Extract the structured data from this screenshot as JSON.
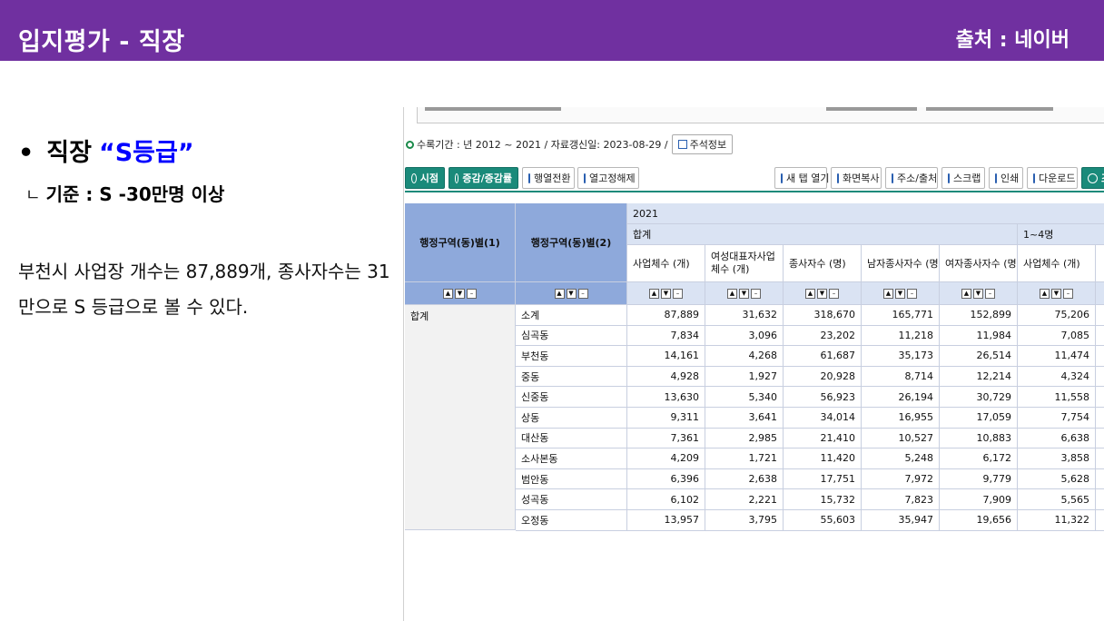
{
  "header": {
    "title": "입지평가 - 직장",
    "source": "출처 : 네이버"
  },
  "left": {
    "bullet": "•",
    "heading": "직장",
    "grade": "“S등급”",
    "criteria_mark": "ㄴ",
    "criteria": "기준 : S -30만명 이상",
    "description": "부천시 사업장 개수는 87,889개, 종사자수는 31만으로 S 등급으로 볼 수 있다."
  },
  "screenshot": {
    "meta": "수록기간 : 년 2012 ~ 2021 / 자료갱신일: 2023-08-29 /",
    "note_button": "주석정보",
    "toolbar_left": [
      "시점",
      "증감/증감률",
      "행열전환",
      "열고정해제"
    ],
    "toolbar_right": [
      "새 탭 열기",
      "화면복사",
      "주소/출처",
      "스크랩",
      "인쇄",
      "다운로드",
      "조"
    ],
    "table": {
      "row_header_1": "행정구역(동)별(1)",
      "row_header_2": "행정구역(동)별(2)",
      "year": "2021",
      "group_total": "합계",
      "group_small": "1~4명",
      "columns": [
        "사업체수 (개)",
        "여성대표자사업체수 (개)",
        "종사자수 (명)",
        "남자종사자수 (명)",
        "여자종사자수 (명)",
        "사업체수 (개)"
      ],
      "group_label": "합계",
      "rows": [
        {
          "name": "소계",
          "values": [
            "87,889",
            "31,632",
            "318,670",
            "165,771",
            "152,899",
            "75,206"
          ]
        },
        {
          "name": "심곡동",
          "values": [
            "7,834",
            "3,096",
            "23,202",
            "11,218",
            "11,984",
            "7,085"
          ]
        },
        {
          "name": "부천동",
          "values": [
            "14,161",
            "4,268",
            "61,687",
            "35,173",
            "26,514",
            "11,474"
          ]
        },
        {
          "name": "중동",
          "values": [
            "4,928",
            "1,927",
            "20,928",
            "8,714",
            "12,214",
            "4,324"
          ]
        },
        {
          "name": "신중동",
          "values": [
            "13,630",
            "5,340",
            "56,923",
            "26,194",
            "30,729",
            "11,558"
          ]
        },
        {
          "name": "상동",
          "values": [
            "9,311",
            "3,641",
            "34,014",
            "16,955",
            "17,059",
            "7,754"
          ]
        },
        {
          "name": "대산동",
          "values": [
            "7,361",
            "2,985",
            "21,410",
            "10,527",
            "10,883",
            "6,638"
          ]
        },
        {
          "name": "소사본동",
          "values": [
            "4,209",
            "1,721",
            "11,420",
            "5,248",
            "6,172",
            "3,858"
          ]
        },
        {
          "name": "범안동",
          "values": [
            "6,396",
            "2,638",
            "17,751",
            "7,972",
            "9,779",
            "5,628"
          ]
        },
        {
          "name": "성곡동",
          "values": [
            "6,102",
            "2,221",
            "15,732",
            "7,823",
            "7,909",
            "5,565"
          ]
        },
        {
          "name": "오정동",
          "values": [
            "13,957",
            "3,795",
            "55,603",
            "35,947",
            "19,656",
            "11,322"
          ]
        }
      ]
    }
  },
  "colors": {
    "banner": "#7030a0",
    "grade": "#0000ff",
    "toolbar_green": "#1a8a7a",
    "header_blue": "#8ea9db",
    "header_light": "#dae3f3"
  }
}
